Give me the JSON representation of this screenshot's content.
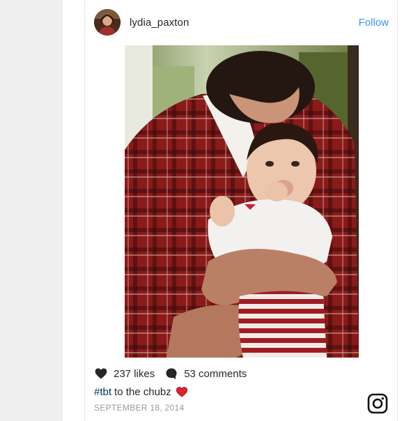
{
  "post": {
    "username": "lydia_paxton",
    "follow_label": "Follow",
    "likes": "237 likes",
    "comments": "53 comments",
    "caption_hashtag": "#tbt",
    "caption_text": "to the chubz",
    "date": "SEPTEMBER 18, 2014"
  },
  "icons": {
    "like": "heart-icon",
    "comment": "comment-bubble-icon",
    "caption_emoji": "red-heart-emoji",
    "brand": "instagram-logo-icon"
  },
  "colors": {
    "follow": "#3897f0",
    "hashtag": "#003569",
    "date": "#999999",
    "emoji_heart": "#e0202f"
  }
}
